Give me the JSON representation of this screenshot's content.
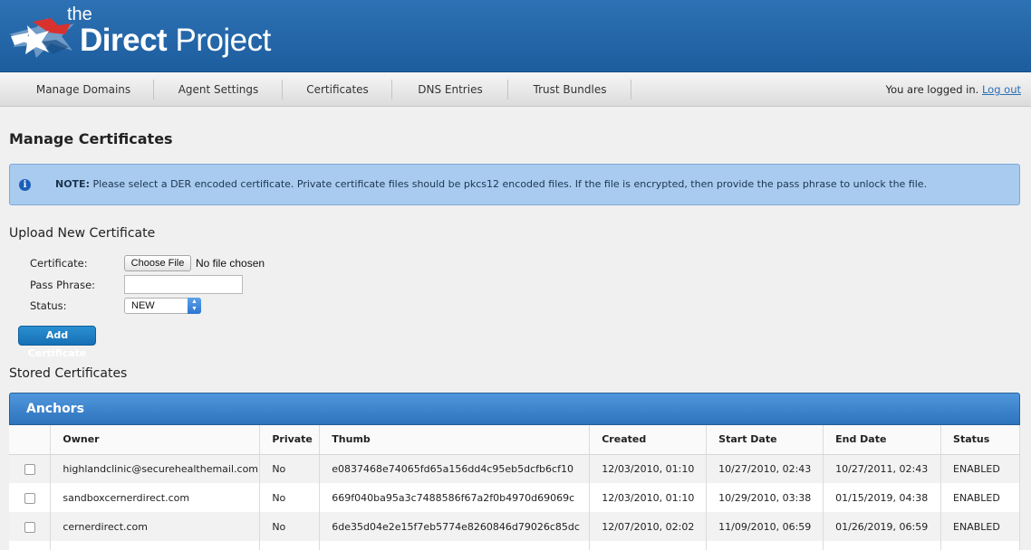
{
  "header": {
    "brand_small": "the",
    "brand_bold": "Direct",
    "brand_rest": " Project"
  },
  "nav": {
    "items": [
      "Manage Domains",
      "Agent Settings",
      "Certificates",
      "DNS Entries",
      "Trust Bundles"
    ],
    "login_text": "You are logged in.",
    "logout_label": "Log out"
  },
  "page_title": "Manage Certificates",
  "note": {
    "label": "NOTE:",
    "text": " Please select a DER encoded certificate. Private certificate files should be pkcs12 encoded files. If the file is encrypted, then provide the pass phrase to unlock the file."
  },
  "upload": {
    "heading": "Upload New Certificate",
    "certificate_label": "Certificate:",
    "choose_file_label": "Choose File",
    "no_file_text": "No file chosen",
    "pass_phrase_label": "Pass Phrase:",
    "pass_phrase_value": "",
    "status_label": "Status:",
    "status_value": "NEW",
    "add_button_label": "Add Certificate"
  },
  "stored": {
    "heading": "Stored Certificates",
    "panel_title": "Anchors",
    "columns": [
      "Owner",
      "Private",
      "Thumb",
      "Created",
      "Start Date",
      "End Date",
      "Status"
    ],
    "rows": [
      [
        "highlandclinic@securehealthemail.com",
        "No",
        "e0837468e74065fd65a156dd4c95eb5dcfb6cf10",
        "12/03/2010, 01:10",
        "10/27/2010, 02:43",
        "10/27/2011, 02:43",
        "ENABLED"
      ],
      [
        "sandboxcernerdirect.com",
        "No",
        "669f040ba95a3c7488586f67a2f0b4970d69069c",
        "12/03/2010, 01:10",
        "10/29/2010, 03:38",
        "01/15/2019, 04:38",
        "ENABLED"
      ],
      [
        "cernerdirect.com",
        "No",
        "6de35d04e2e15f7eb5774e8260846d79026c85dc",
        "12/07/2010, 02:02",
        "11/09/2010, 06:59",
        "01/26/2019, 06:59",
        "ENABLED"
      ]
    ]
  },
  "colors": {
    "header": "#2d72b4",
    "note_bg": "#a8cbef",
    "panel": "#3a82cc",
    "button": "#1f80c4"
  },
  "icons": {
    "logo": "star-logo-icon",
    "note": "info-icon",
    "select": "updown-arrows-icon"
  }
}
